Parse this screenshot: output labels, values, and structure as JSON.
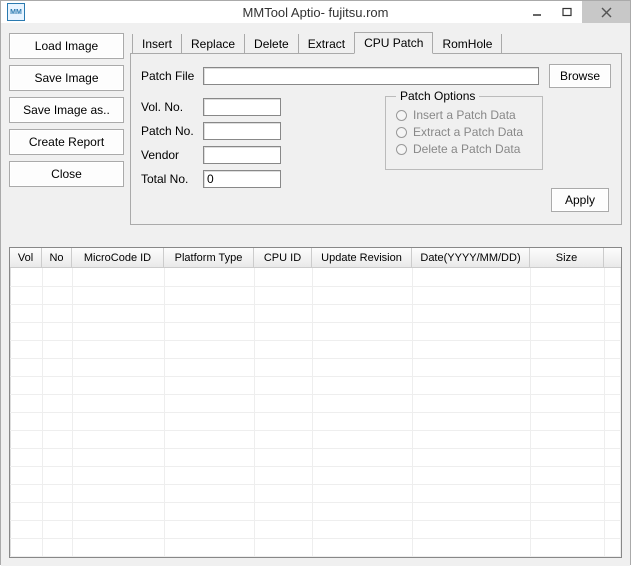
{
  "window": {
    "title": "MMTool Aptio- fujitsu.rom",
    "icon_text": "MM"
  },
  "buttons": {
    "load_image": "Load Image",
    "save_image": "Save Image",
    "save_image_as": "Save Image as..",
    "create_report": "Create Report",
    "close": "Close",
    "browse": "Browse",
    "apply": "Apply"
  },
  "tabs": {
    "insert": "Insert",
    "replace": "Replace",
    "delete": "Delete",
    "extract": "Extract",
    "cpu_patch": "CPU Patch",
    "romhole": "RomHole"
  },
  "form": {
    "patch_file_label": "Patch File",
    "patch_file_value": "",
    "vol_no_label": "Vol. No.",
    "vol_no_value": "",
    "patch_no_label": "Patch No.",
    "patch_no_value": "",
    "vendor_label": "Vendor",
    "vendor_value": "",
    "total_no_label": "Total No.",
    "total_no_value": "0"
  },
  "patch_options": {
    "legend": "Patch Options",
    "opt1": "Insert a Patch Data",
    "opt2": "Extract a Patch Data",
    "opt3": "Delete a Patch Data"
  },
  "grid": {
    "columns": [
      {
        "label": "Vol",
        "width": 32
      },
      {
        "label": "No",
        "width": 30
      },
      {
        "label": "MicroCode ID",
        "width": 92
      },
      {
        "label": "Platform Type",
        "width": 90
      },
      {
        "label": "CPU ID",
        "width": 58
      },
      {
        "label": "Update Revision",
        "width": 100
      },
      {
        "label": "Date(YYYY/MM/DD)",
        "width": 118
      },
      {
        "label": "Size",
        "width": 74
      }
    ],
    "rows": []
  }
}
